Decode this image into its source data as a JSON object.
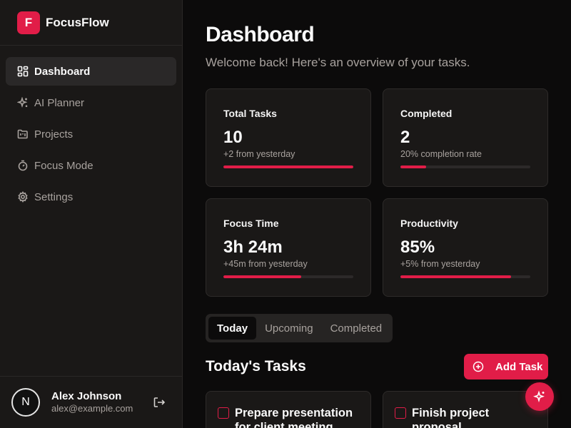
{
  "brand": {
    "logo_letter": "F",
    "name": "FocusFlow"
  },
  "nav": {
    "items": [
      {
        "label": "Dashboard",
        "icon": "layout-dashboard-icon",
        "active": true
      },
      {
        "label": "AI Planner",
        "icon": "sparkles-icon"
      },
      {
        "label": "Projects",
        "icon": "folder-kanban-icon"
      },
      {
        "label": "Focus Mode",
        "icon": "timer-icon"
      },
      {
        "label": "Settings",
        "icon": "gear-icon"
      }
    ]
  },
  "user": {
    "avatar_initial": "N",
    "name": "Alex Johnson",
    "email": "alex@example.com"
  },
  "header": {
    "title": "Dashboard",
    "subtitle": "Welcome back! Here's an overview of your tasks."
  },
  "stats": [
    {
      "label": "Total Tasks",
      "value": "10",
      "sub": "+2 from yesterday",
      "progress": 1.0
    },
    {
      "label": "Completed",
      "value": "2",
      "sub": "20% completion rate",
      "progress": 0.2
    },
    {
      "label": "Focus Time",
      "value": "3h 24m",
      "sub": "+45m from yesterday",
      "progress": 0.6
    },
    {
      "label": "Productivity",
      "value": "85%",
      "sub": "+5% from yesterday",
      "progress": 0.85
    }
  ],
  "tabs": [
    {
      "label": "Today",
      "active": true
    },
    {
      "label": "Upcoming"
    },
    {
      "label": "Completed"
    }
  ],
  "tasks_section": {
    "title": "Today's Tasks",
    "add_label": "Add Task"
  },
  "tasks": [
    {
      "title": "Prepare presentation for client meeting"
    },
    {
      "title": "Finish project proposal"
    }
  ],
  "colors": {
    "accent": "#e11d48",
    "background": "#0c0b0b",
    "sidebar": "#1a1817",
    "card": "#1a1817"
  }
}
